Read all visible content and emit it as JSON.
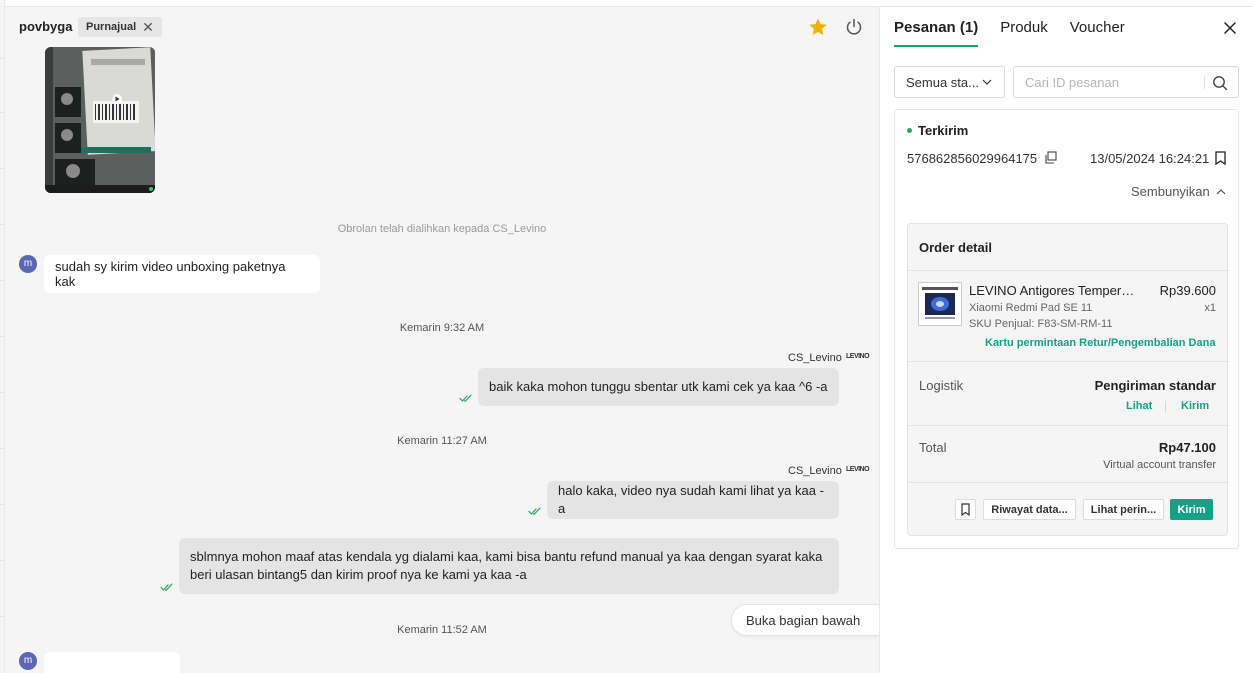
{
  "chat": {
    "username": "povbyga",
    "role_badge": "Purnajual",
    "system_message": "Obrolan telah dialihkan kepada CS_Levino",
    "agent_name": "CS_Levino",
    "agent_logo_text": "LEVINO",
    "customer_avatar": "m",
    "jump_to_bottom": "Buka bagian bawah",
    "messages": [
      {
        "from": "customer",
        "text": "sudah sy kirim video unboxing paketnya kak"
      },
      {
        "time": "Kemarin 9:32 AM"
      },
      {
        "from": "agent",
        "text": "baik kaka mohon tunggu sbentar utk kami cek ya kaa ^6 -a"
      },
      {
        "time": "Kemarin 11:27 AM"
      },
      {
        "from": "agent",
        "text": "halo kaka, video nya sudah kami lihat ya kaa -a"
      },
      {
        "from": "agent",
        "text_line1": "sblmnya mohon maaf atas kendala yg dialami kaa, kami bisa bantu refund manual ya kaa dengan syarat kaka",
        "text_line2": "beri ulasan bintang5 dan kirim proof nya ke kami ya kaa -a"
      },
      {
        "time": "Kemarin 11:52 AM"
      }
    ]
  },
  "panel": {
    "tabs": [
      {
        "label": "Pesanan (1)",
        "active": true
      },
      {
        "label": "Produk",
        "active": false
      },
      {
        "label": "Voucher",
        "active": false
      }
    ],
    "status_filter": "Semua sta...",
    "search_placeholder": "Cari ID pesanan",
    "order": {
      "status": "Terkirim",
      "id": "576862856029964175",
      "date": "13/05/2024 16:24:21",
      "hide_label": "Sembunyikan",
      "detail_title": "Order detail",
      "product": {
        "name": "LEVINO Antigores Tempere...",
        "price": "Rp39.600",
        "variant": "Xiaomi Redmi Pad SE 11",
        "qty": "x1",
        "sku": "SKU Penjual: F83-SM-RM-11"
      },
      "return_link": "Kartu permintaan Retur/Pengembalian Dana",
      "logistics_label": "Logistik",
      "logistics_value": "Pengiriman standar",
      "logistics_link_view": "Lihat",
      "logistics_link_send": "Kirim",
      "total_label": "Total",
      "total_value": "Rp47.100",
      "payment_method": "Virtual account transfer",
      "actions": {
        "history": "Riwayat data...",
        "view_detail": "Lihat perin...",
        "send": "Kirim"
      }
    }
  },
  "colors": {
    "accent": "#16a085",
    "star": "#f0b400",
    "status_dot": "#26aa5a",
    "avatar": "#5b67b3"
  }
}
